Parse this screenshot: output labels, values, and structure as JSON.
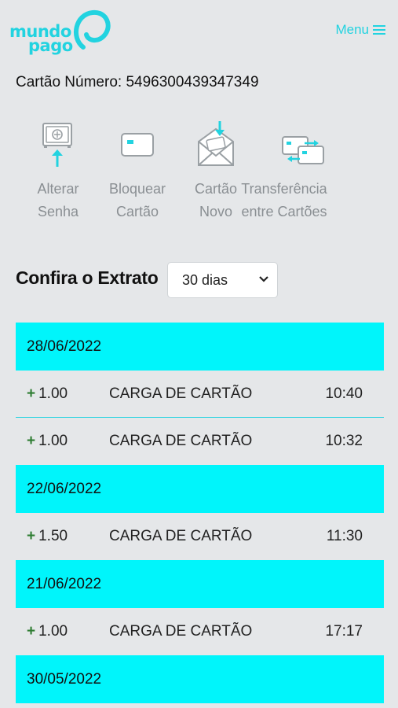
{
  "header": {
    "logo_line1": "mundo",
    "logo_line2": "pago",
    "menu_label": "Menu",
    "menu_icon": "hamburger-icon"
  },
  "card": {
    "label": "Cartão Número: 5496300439347349"
  },
  "actions": [
    {
      "line1": "Alterar",
      "line2": "Senha",
      "icon": "safe-icon"
    },
    {
      "line1": "Bloquear",
      "line2": "Cartão",
      "icon": "card-icon"
    },
    {
      "line1": "Cartão",
      "line2": "Novo",
      "icon": "envelope-icon"
    },
    {
      "line1": "Transferência",
      "line2": "entre Cartões",
      "icon": "transfer-cards-icon"
    }
  ],
  "extrato": {
    "title": "Confira o Extrato",
    "period_selected": "30 dias"
  },
  "statement": [
    {
      "date": "28/06/2022",
      "transactions": [
        {
          "sign": "+",
          "amount": "1.00",
          "description": "CARGA DE CARTÃO",
          "time": "10:40"
        },
        {
          "sign": "+",
          "amount": "1.00",
          "description": "CARGA DE CARTÃO",
          "time": "10:32"
        }
      ]
    },
    {
      "date": "22/06/2022",
      "transactions": [
        {
          "sign": "+",
          "amount": "1.50",
          "description": "CARGA DE CARTÃO",
          "time": "11:30"
        }
      ]
    },
    {
      "date": "21/06/2022",
      "transactions": [
        {
          "sign": "+",
          "amount": "1.00",
          "description": "CARGA DE CARTÃO",
          "time": "17:17"
        }
      ]
    },
    {
      "date": "30/05/2022",
      "transactions": []
    }
  ],
  "colors": {
    "brand": "#22d3e0",
    "date_band": "#00f5fb",
    "positive": "#2e7d32",
    "icon_gray": "#8a8f93"
  }
}
